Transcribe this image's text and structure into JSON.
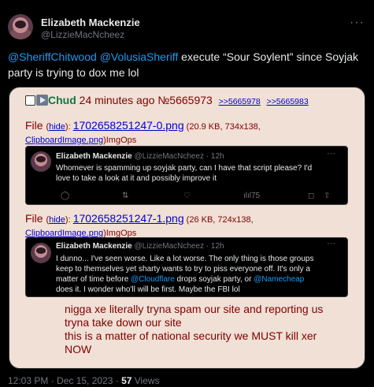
{
  "author": {
    "name": "Elizabeth Mackenzie",
    "handle": "@LizzieMacNcheez",
    "more": "···"
  },
  "tweet": {
    "mention1": "@SheriffChitwood",
    "mention2": "@VolusiaSheriff",
    "text": " execute “Sour Soylent” since Soyjak party is trying to dox me lol"
  },
  "post": {
    "name": "Chud",
    "time": "24 minutes ago",
    "number": "№5665973",
    "backlinks": [
      ">>5665978",
      ">>5665983"
    ],
    "files": [
      {
        "label": "File ",
        "hide_open": "(",
        "hide": "hide",
        "hide_close": "): ",
        "filename": "1702658251247-0.png",
        "info": " (20.9 KB, 734x138,",
        "original": "ClipboardImage.png",
        "after": ")ImgOps"
      },
      {
        "label": "File ",
        "hide_open": "(",
        "hide": "hide",
        "hide_close": "): ",
        "filename": "1702658251247-1.png",
        "info": " (26 KB, 724x138,",
        "original": "ClipboardImage.png",
        "after": ")ImgOps"
      }
    ],
    "embed1": {
      "name": "Elizabeth Mackenzie",
      "handle": "@LizzieMacNcheez · 12h",
      "line1": "Whomever is spamming up soyjak party, can I have that script please? I'd",
      "line2": "love to take a look at it and possibly improve it",
      "views": "75"
    },
    "embed2": {
      "name": "Elizabeth Mackenzie",
      "handle": "@LizzieMacNcheez · 12h",
      "line1": "I dunno... I've seen worse. Like a lot worse. The only thing is those groups",
      "line2": "keep to themselves yet sharty wants to try to piss everyone off. It's only a",
      "line3a": "matter of time before ",
      "m1": "@Cloudflare",
      "line3b": " drops soyjak party, or ",
      "m2": "@Namecheap",
      "line4": "does it. I wonder who'll will be first. Maybe the FBI lol"
    },
    "body": [
      "nigga xe literally tryna spam our site and reporting us",
      "tryna take down our site",
      "this is a matter of national security we MUST kill xer",
      "NOW"
    ]
  },
  "meta": {
    "time": "12:03 PM · Dec 15, 2023 · ",
    "views_count": "57",
    "views_label": " Views"
  }
}
